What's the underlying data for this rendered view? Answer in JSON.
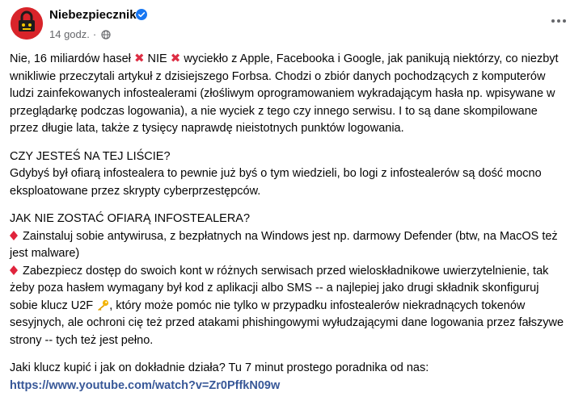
{
  "post": {
    "page_name": "Niebezpiecznik",
    "time": "14 godz.",
    "dot": "·",
    "para1_a": "Nie, 16 miliardów haseł",
    "para1_b": "NIE",
    "para1_c": "wyciekło z Apple, Facebooka i Google, jak panikują niektórzy, co niezbyt wnikliwie przeczytali artykuł z dzisiejszego Forbsa. Chodzi o zbiór danych pochodzących z komputerów ludzi zainfekowanych infostealerami (złośliwym oprogramowaniem wykradającym hasła np. wpisywane w przeglądarkę podczas logowania), a nie wyciek z tego czy innego serwisu. I to są dane skompilowane przez długie lata, także z tysięcy naprawdę nieistotnych punktów logowania.",
    "q1_heading": "CZY JESTEŚ NA TEJ LIŚCIE?",
    "q1_text": "Gdybyś był ofiarą infostealera to pewnie już byś o tym wiedzieli, bo logi z infostealerów są dość mocno eksploatowane przez skrypty cyberprzestępców.",
    "q2_heading": "JAK NIE ZOSTAĆ OFIARĄ INFOSTEALERA?",
    "tip1": "Zainstaluj sobie antywirusa, z bezpłatnych na Windows jest np. darmowy Defender (btw, na MacOS też jest malware)",
    "tip2_a": "Zabezpiecz dostęp do swoich kont w różnych serwisach przed wieloskładnikowe uwierzytelnienie, tak żeby poza hasłem wymagany był kod z aplikacji albo SMS -- a najlepiej jako drugi składnik skonfiguruj sobie klucz U2F",
    "tip2_b": ", który może pomóc nie tylko w przypadku infostealerów niekradnących tokenów sesyjnych, ale ochroni cię też przed atakami phishingowymi wyłudzającymi dane logowania przez fałszywe strony -- tych też jest pełno.",
    "final_text": "Jaki klucz kupić i jak on dokładnie działa? Tu 7 minut prostego poradnika od nas:",
    "link": "https://www.youtube.com/watch?v=Zr0PffkN09w"
  },
  "icons": {
    "verified": "verified-badge-icon",
    "globe": "globe-icon",
    "more": "more-options-icon",
    "cross": "cross-mark-icon",
    "diamond": "red-diamond-icon",
    "key": "key-icon"
  },
  "colors": {
    "link": "#385898",
    "verified": "#1877f2",
    "avatar_bg": "#d8242a",
    "cross": "#dd2e44",
    "diamond": "#e0243c",
    "meta": "#65676b"
  }
}
